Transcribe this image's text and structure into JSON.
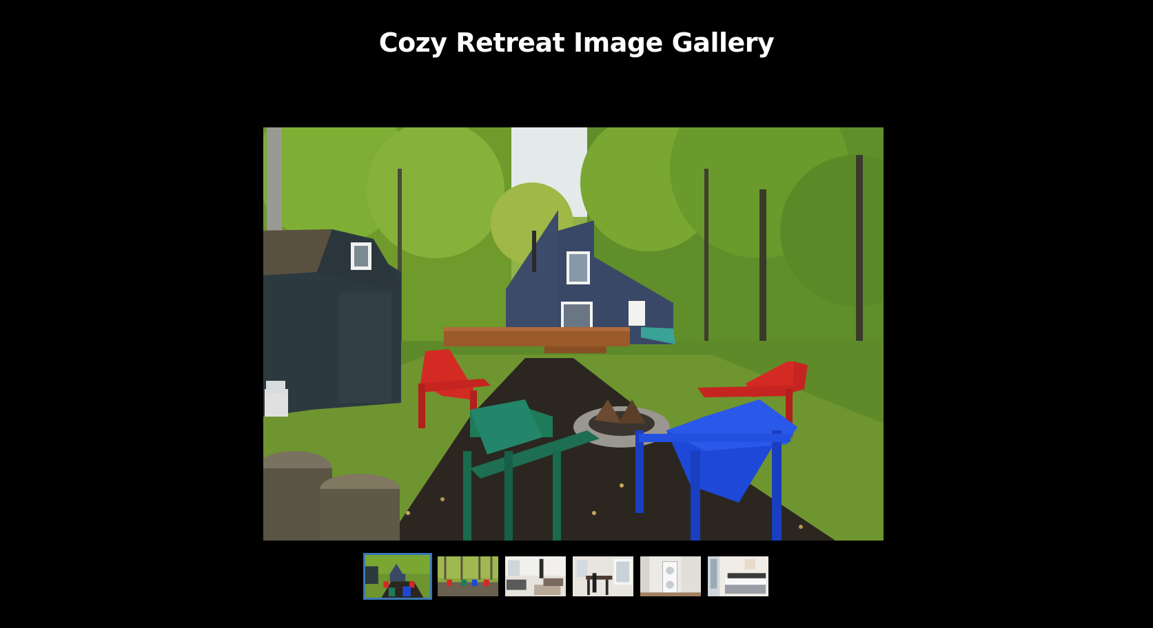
{
  "gallery": {
    "title": "Cozy Retreat Image Gallery",
    "active_index": 0,
    "main_image": {
      "name": "cabin-exterior-firepit-photo"
    },
    "thumbnails": [
      {
        "name": "cabin-exterior-firepit-thumbnail",
        "active": true
      },
      {
        "name": "forest-chairs-thumbnail",
        "active": false
      },
      {
        "name": "living-room-thumbnail",
        "active": false
      },
      {
        "name": "dining-room-thumbnail",
        "active": false
      },
      {
        "name": "laundry-room-thumbnail",
        "active": false
      },
      {
        "name": "bedroom-thumbnail",
        "active": false
      }
    ]
  },
  "colors": {
    "background": "#000000",
    "active_border": "#3a78b5",
    "title_text": "#ffffff"
  }
}
